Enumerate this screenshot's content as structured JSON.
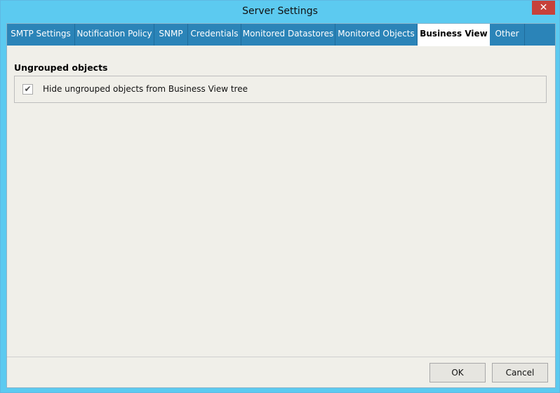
{
  "window": {
    "title": "Server Settings",
    "close_glyph": "✕"
  },
  "tabs": [
    {
      "label": "SMTP Settings"
    },
    {
      "label": "Notification Policy"
    },
    {
      "label": "SNMP"
    },
    {
      "label": "Credentials"
    },
    {
      "label": "Monitored Datastores"
    },
    {
      "label": "Monitored Objects"
    },
    {
      "label": "Business View"
    },
    {
      "label": "Other"
    }
  ],
  "active_tab": "Business View",
  "content": {
    "group_title": "Ungrouped objects",
    "checkbox": {
      "label": "Hide ungrouped objects from Business View tree",
      "checked": true,
      "glyph": "✔"
    }
  },
  "buttons": {
    "ok": "OK",
    "cancel": "Cancel"
  },
  "colors": {
    "titlebar": "#5ccaf0",
    "tabstrip": "#2b84b8",
    "close": "#c7413a"
  }
}
